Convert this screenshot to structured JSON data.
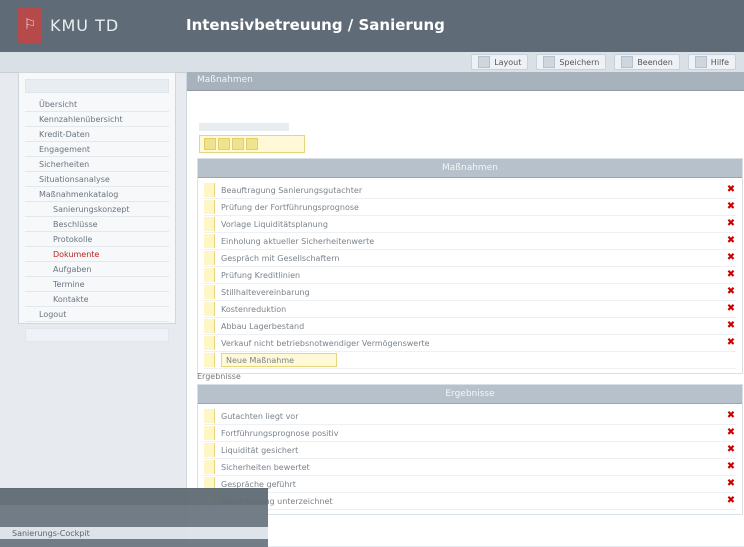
{
  "header": {
    "logo_text": "KMU TD",
    "title": "Intensivbetreuung / Sanierung"
  },
  "toolbar": {
    "items": [
      "Layout",
      "Speichern",
      "Beenden",
      "Hilfe"
    ]
  },
  "sidebar": {
    "items": [
      "Übersicht",
      "Kennzahlenübersicht",
      "Kredit-Daten",
      "Engagement",
      "Sicherheiten",
      "Situationsanalyse",
      "Maßnahmenkatalog",
      "Sanierungskonzept",
      "Beschlüsse",
      "Protokolle",
      "Dokumente",
      "Aufgaben",
      "Termine",
      "Kontakte",
      "Logout"
    ],
    "sub_start_index": 7,
    "active_index": 10
  },
  "main": {
    "header_title": "Maßnahmen",
    "section1": {
      "title": "Maßnahmen",
      "rows": [
        "Beauftragung Sanierungsgutachter",
        "Prüfung der Fortführungsprognose",
        "Vorlage Liquiditätsplanung",
        "Einholung aktueller Sicherheitenwerte",
        "Gespräch mit Gesellschaftern",
        "Prüfung Kreditlinien",
        "Stillhaltevereinbarung",
        "Kostenreduktion",
        "Abbau Lagerbestand",
        "Verkauf nicht betriebsnotwendiger Vermögenswerte"
      ],
      "add_label": "Neue Maßnahme"
    },
    "section2_caption": "Ergebnisse",
    "section2": {
      "title": "Ergebnisse",
      "rows": [
        "Gutachten liegt vor",
        "Fortführungsprognose positiv",
        "Liquidität gesichert",
        "Sicherheiten bewertet",
        "Gespräche geführt",
        "Vereinbarung unterzeichnet"
      ]
    }
  },
  "overlay": {
    "strip_text": "Sanierungs-Cockpit"
  },
  "colors": {
    "header": "#5f6b76",
    "accent_red": "#c00",
    "handle": "#fff6c5"
  }
}
